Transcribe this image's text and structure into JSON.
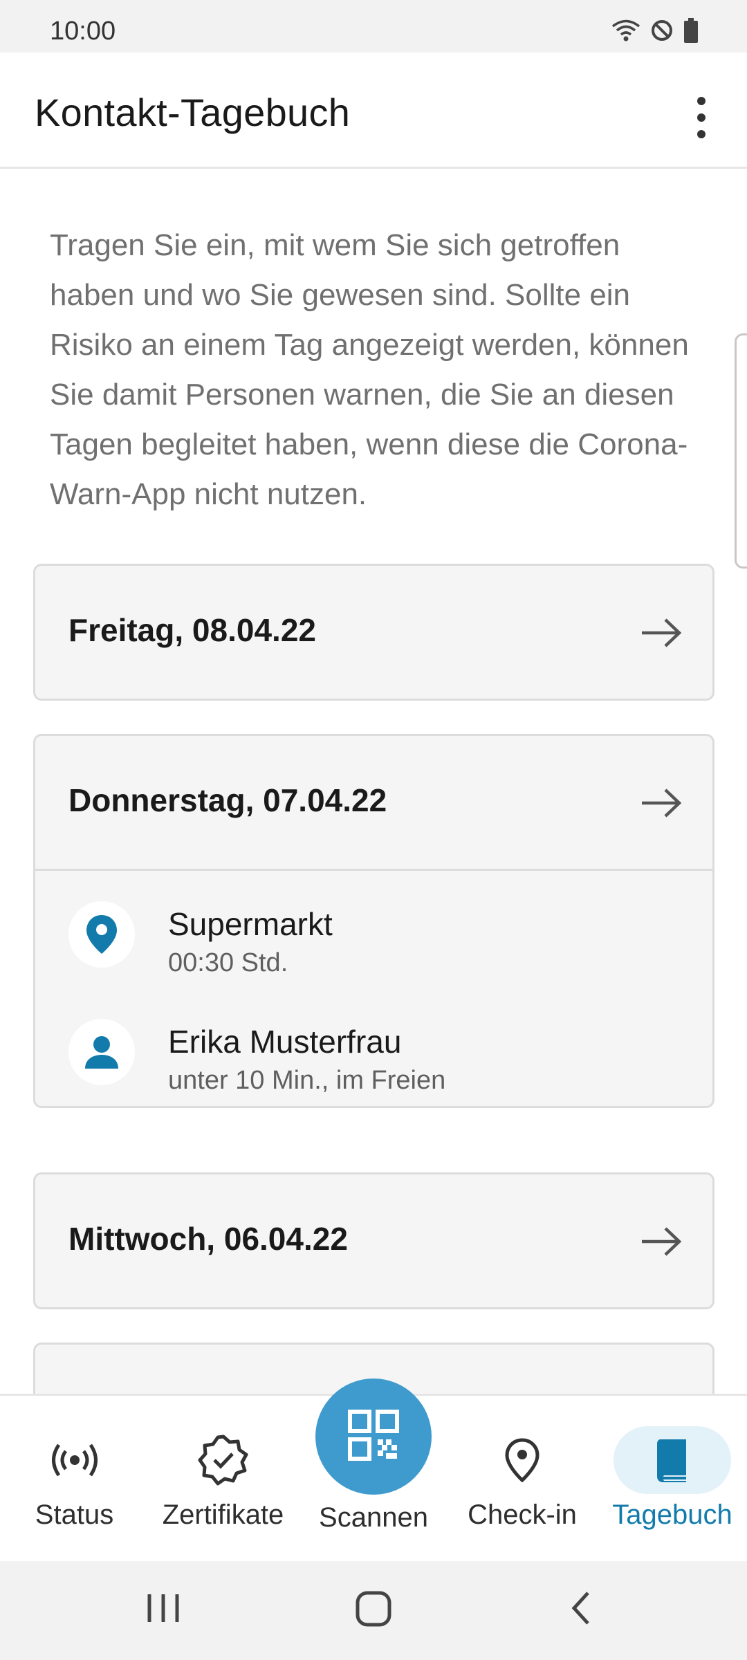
{
  "status_bar": {
    "time": "10:00",
    "icons": [
      "wifi-icon",
      "do-not-disturb-icon",
      "battery-icon"
    ]
  },
  "app_bar": {
    "title": "Kontakt-Tagebuch",
    "overflow_icon": "more-vert-icon"
  },
  "intro_text": "Tragen Sie ein, mit wem Sie sich getroffen haben und wo Sie gewesen sind. Sollte ein Risiko an einem Tag angezeigt werden, können Sie damit Personen warnen, die Sie an diesen Tagen begleitet haben, wenn diese die Corona-Warn-App nicht nutzen.",
  "days": [
    {
      "label": "Freitag, 08.04.22",
      "entries": []
    },
    {
      "label": "Donnerstag, 07.04.22",
      "entries": [
        {
          "icon": "location-pin-icon",
          "name": "Supermarkt",
          "detail": "00:30 Std."
        },
        {
          "icon": "person-icon",
          "name": "Erika Musterfrau",
          "detail": "unter 10 Min., im Freien"
        }
      ]
    },
    {
      "label": "Mittwoch, 06.04.22",
      "entries": []
    }
  ],
  "bottom_nav": {
    "items": [
      {
        "label": "Status",
        "icon": "broadcast-icon",
        "active": false
      },
      {
        "label": "Zertifikate",
        "icon": "verified-badge-icon",
        "active": false
      },
      {
        "label": "Scannen",
        "icon": "qr-code-icon",
        "active": false
      },
      {
        "label": "Check-in",
        "icon": "location-pin-icon",
        "active": false
      },
      {
        "label": "Tagebuch",
        "icon": "book-icon",
        "active": true
      }
    ]
  },
  "colors": {
    "accent": "#137bab",
    "fab": "#3f9bcd",
    "card_bg": "#f5f5f5",
    "card_border": "#dcdcdc"
  }
}
